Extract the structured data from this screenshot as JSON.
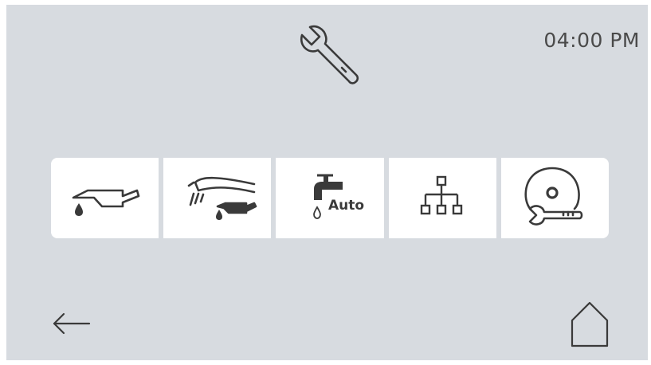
{
  "header": {
    "icon": "wrench-icon",
    "time": "04:00 PM"
  },
  "toolbar": {
    "items": [
      {
        "name": "oil-can",
        "icon": "oil-can-icon"
      },
      {
        "name": "handpiece-oil",
        "icon": "handpiece-oil-icon"
      },
      {
        "name": "auto-water",
        "icon": "water-tap-icon",
        "label": "Auto"
      },
      {
        "name": "network",
        "icon": "hierarchy-icon"
      },
      {
        "name": "disc-service",
        "icon": "disc-wrench-icon"
      }
    ]
  },
  "footer": {
    "back_icon": "arrow-left-icon",
    "home_icon": "home-icon"
  },
  "colors": {
    "background": "#d7dbe0",
    "tile": "#ffffff",
    "icon": "#3a3a3a"
  }
}
